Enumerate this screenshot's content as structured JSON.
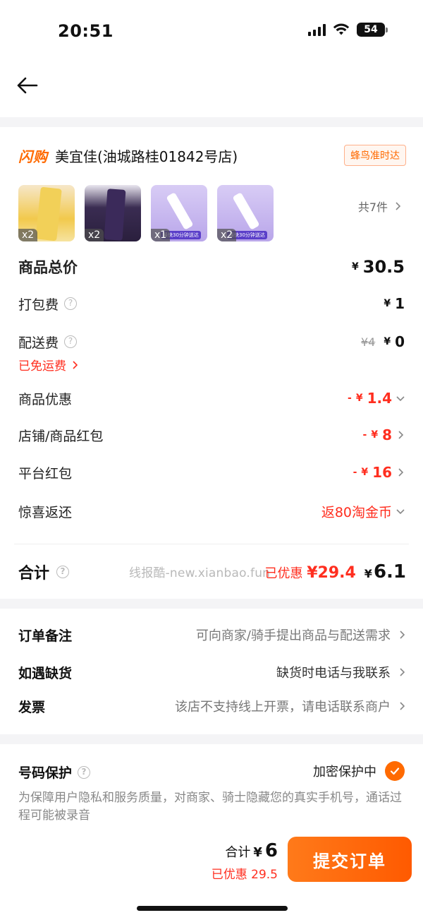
{
  "status_bar": {
    "time": "20:51",
    "battery": "54"
  },
  "store": {
    "platform_tag": "闪购",
    "name": "美宜佳(油城路桂01842号店)",
    "delivery_badge": "蜂鸟准时达"
  },
  "products": [
    {
      "qty": "x2"
    },
    {
      "qty": "x2"
    },
    {
      "qty": "x1",
      "tag": "最快30分钟送达"
    },
    {
      "qty": "x2",
      "tag": "最快30分钟送达"
    }
  ],
  "products_total_label": "共7件",
  "fees": {
    "goods_total_label": "商品总价",
    "goods_total_value": "30.5",
    "packing_label": "打包费",
    "packing_value": "1",
    "delivery_label": "配送费",
    "delivery_original": "¥4",
    "delivery_value": "0",
    "free_shipping_text": "已免运费",
    "goods_discount_label": "商品优惠",
    "goods_discount_value": "1.4",
    "store_redpacket_label": "店铺/商品红包",
    "store_redpacket_value": "8",
    "platform_redpacket_label": "平台红包",
    "platform_redpacket_value": "16",
    "surprise_label": "惊喜返还",
    "surprise_value": "返80淘金币"
  },
  "summary": {
    "label": "合计",
    "watermark": "线报酷-new.xianbao.fun",
    "saved_label": "已优惠",
    "saved_value": "¥29.4",
    "total_value": "6.1"
  },
  "order_info": {
    "remark_label": "订单备注",
    "remark_value": "可向商家/骑手提出商品与配送需求",
    "shortage_label": "如遇缺货",
    "shortage_value": "缺货时电话与我联系",
    "invoice_label": "发票",
    "invoice_value": "该店不支持线上开票，请电话联系商户"
  },
  "privacy": {
    "title": "号码保护",
    "status": "加密保护中",
    "description": "为保障用户隐私和服务质量，对商家、骑士隐藏您的真实手机号，通话过程可能被录音"
  },
  "footer": {
    "total_label": "合计",
    "total_value": "6",
    "saved_text": "已优惠 29.5",
    "submit_label": "提交订单"
  },
  "colors": {
    "accent": "#ff6a00",
    "price_red": "#ff2e1f",
    "band": "#f4f4f6"
  },
  "yen_symbol": "¥",
  "minus_sign": "-"
}
